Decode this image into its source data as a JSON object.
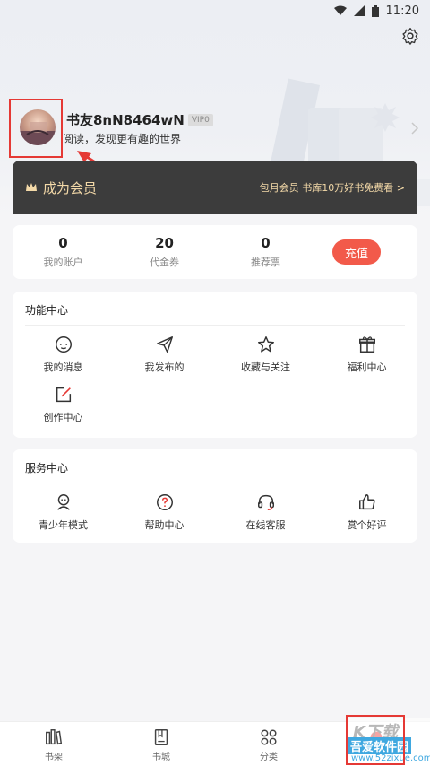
{
  "status_bar": {
    "time": "11:20"
  },
  "profile": {
    "username": "书友8nN8464wN",
    "vip_level": "VIP0",
    "tagline": "阅读，发现更有趣的世界"
  },
  "vip_banner": {
    "title": "成为会员",
    "promo": "包月会员 书库10万好书免费看 >"
  },
  "wallet": {
    "items": [
      {
        "value": "0",
        "label": "我的账户"
      },
      {
        "value": "20",
        "label": "代金券"
      },
      {
        "value": "0",
        "label": "推荐票"
      }
    ],
    "recharge_label": "充值"
  },
  "function_center": {
    "title": "功能中心",
    "items": [
      {
        "label": "我的消息",
        "icon": "message-icon"
      },
      {
        "label": "我发布的",
        "icon": "send-icon"
      },
      {
        "label": "收藏与关注",
        "icon": "star-icon"
      },
      {
        "label": "福利中心",
        "icon": "gift-icon"
      },
      {
        "label": "创作中心",
        "icon": "edit-icon"
      }
    ]
  },
  "service_center": {
    "title": "服务中心",
    "items": [
      {
        "label": "青少年模式",
        "icon": "teen-mode-icon"
      },
      {
        "label": "帮助中心",
        "icon": "help-icon"
      },
      {
        "label": "在线客服",
        "icon": "headset-icon"
      },
      {
        "label": "赏个好评",
        "icon": "thumbs-up-icon"
      }
    ]
  },
  "bottom_nav": {
    "items": [
      {
        "label": "书架",
        "icon": "bookshelf-icon"
      },
      {
        "label": "书城",
        "icon": "bookstore-icon"
      },
      {
        "label": "分类",
        "icon": "category-icon"
      }
    ]
  },
  "watermark": {
    "top": "K下载",
    "middle": "吾爱软件园",
    "bottom": "www.52zixue.com"
  },
  "colors": {
    "accent": "#f25a4a",
    "vip_bg": "#3c3c3c",
    "vip_text": "#f3d9a8",
    "annotation": "#e53935"
  }
}
